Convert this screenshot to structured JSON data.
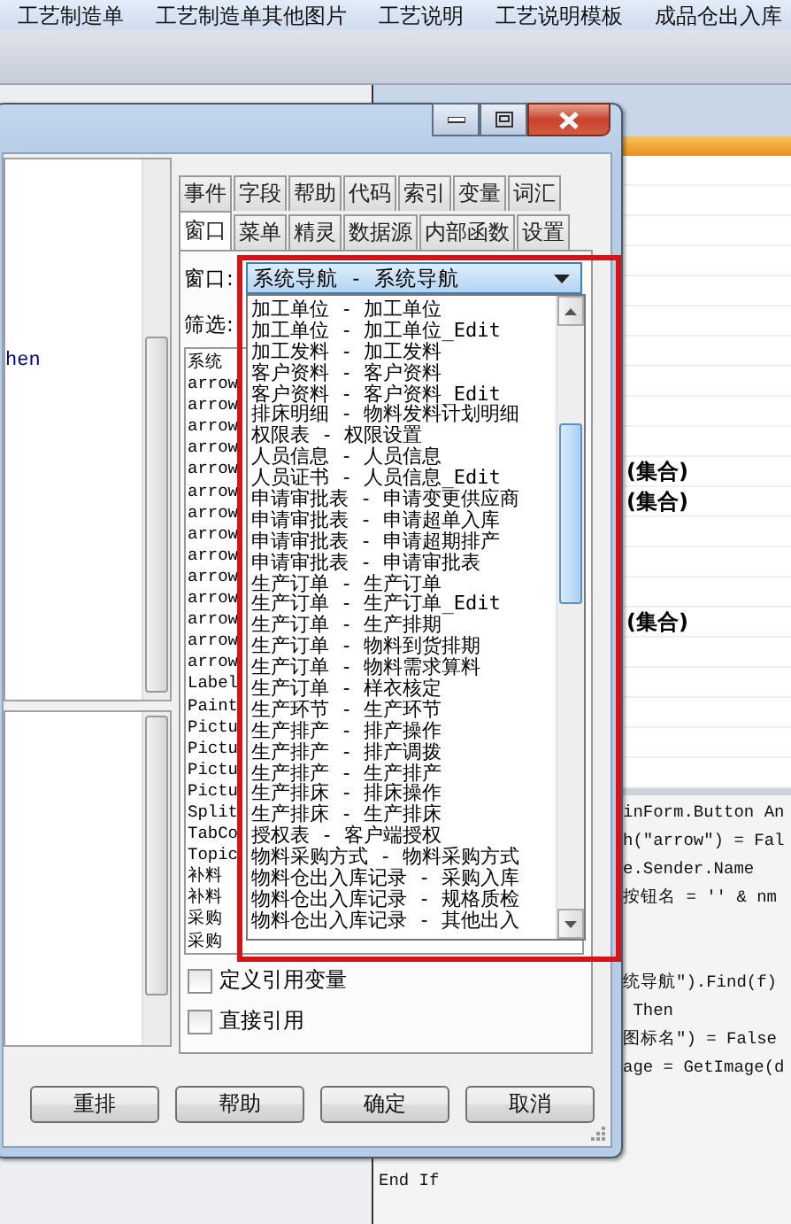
{
  "app": {
    "menu": [
      "工艺制造单",
      "工艺制造单其他图片",
      "工艺说明",
      "工艺说明模板",
      "成品仓出入库"
    ],
    "property_values": [
      "(集合)",
      "(集合)",
      "(集合)"
    ],
    "code_lines_top": [
      "inForm.Button An",
      "h(\"arrow\") = Fal",
      "e.Sender.Name",
      "按钮名 = '' & nm"
    ],
    "code_lines_bottom": [
      "统导航\").Find(f)",
      " Then",
      "图标名\") = False",
      "age = GetImage(d"
    ],
    "code_end": "End If"
  },
  "dialog": {
    "preview_line": "hen",
    "tab_rows": [
      [
        {
          "label": "事件",
          "selected": false
        },
        {
          "label": "字段",
          "selected": false
        },
        {
          "label": "帮助",
          "selected": false
        },
        {
          "label": "代码",
          "selected": false
        },
        {
          "label": "索引",
          "selected": false
        },
        {
          "label": "变量",
          "selected": false
        },
        {
          "label": "词汇",
          "selected": false
        }
      ],
      [
        {
          "label": "窗口",
          "selected": true
        },
        {
          "label": "菜单",
          "selected": false
        },
        {
          "label": "精灵",
          "selected": false
        },
        {
          "label": "数据源",
          "selected": false
        },
        {
          "label": "内部函数",
          "selected": false
        },
        {
          "label": "设置",
          "selected": false
        }
      ]
    ],
    "window_label": "窗口:",
    "window_combo": {
      "value": "系统导航 - 系统导航",
      "expanded": true
    },
    "filter_label": "筛选:",
    "objects": [
      "系统",
      "arrow",
      "arrow",
      "arrow",
      "arrow",
      "arrow",
      "arrow",
      "arrow",
      "arrow",
      "arrow",
      "arrow",
      "arrow",
      "arrow",
      "arrow",
      "arrow",
      "Label",
      "Paint",
      "Pictu",
      "Pictu",
      "Pictu",
      "Pictu",
      "Split",
      "TabCo",
      "Topic",
      "补料",
      "补料",
      "采购",
      "采购"
    ],
    "dropdown_items": [
      "加工单位 - 加工单位",
      "加工单位 - 加工单位_Edit",
      "加工发料 - 加工发料",
      "客户资料 - 客户资料",
      "客户资料 - 客户资料_Edit",
      "排床明细 - 物料发料计划明细",
      "权限表 - 权限设置",
      "人员信息 - 人员信息",
      "人员证书 - 人员信息_Edit",
      "申请审批表 - 申请变更供应商",
      "申请审批表 - 申请超单入库",
      "申请审批表 - 申请超期排产",
      "申请审批表 - 申请审批表",
      "生产订单 - 生产订单",
      "生产订单 - 生产订单_Edit",
      "生产订单 - 生产排期",
      "生产订单 - 物料到货排期",
      "生产订单 - 物料需求算料",
      "生产订单 - 样衣核定",
      "生产环节 - 生产环节",
      "生产排产 - 排产操作",
      "生产排产 - 排产调拨",
      "生产排产 - 生产排产",
      "生产排床 - 排床操作",
      "生产排床 - 生产排床",
      "授权表 - 客户端授权",
      "物料采购方式 - 物料采购方式",
      "物料仓出入库记录 - 采购入库",
      "物料仓出入库记录 - 规格质检",
      "物料仓出入库记录 - 其他出入"
    ],
    "checkboxes": [
      {
        "label": "定义引用变量",
        "checked": false
      },
      {
        "label": "直接引用",
        "checked": false
      }
    ],
    "buttons": [
      "重排",
      "帮助",
      "确定",
      "取消"
    ]
  }
}
